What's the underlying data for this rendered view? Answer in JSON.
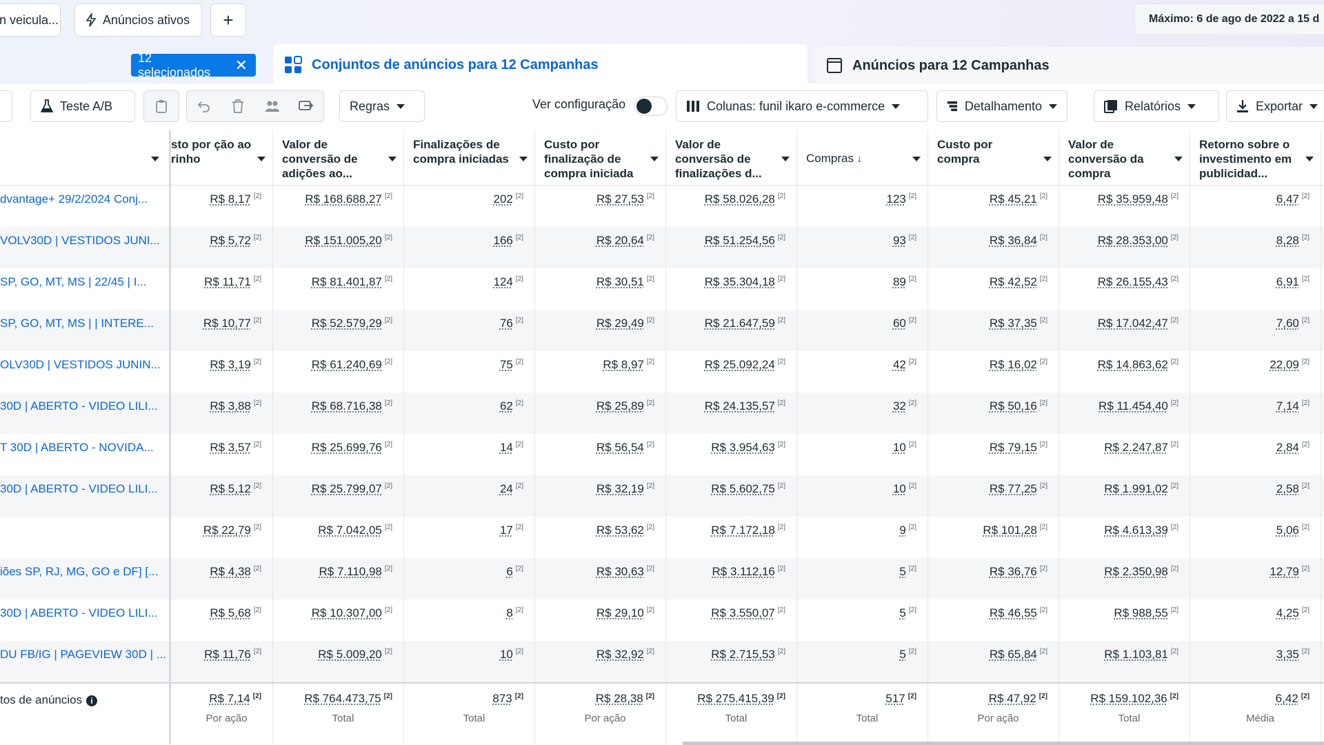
{
  "top_chips": {
    "left_partial": "n veicula...",
    "active_ads": "Anúncios ativos",
    "plus": "+"
  },
  "date_range": "Máximo: 6 de ago de 2022 a 15 d",
  "selection": {
    "label": "12 selecionados",
    "clear": "✕"
  },
  "tabs": {
    "adsets": "Conjuntos de anúncios para 12 Campanhas",
    "ads": "Anúncios para 12 Campanhas"
  },
  "toolbar": {
    "ab_test": "Teste A/B",
    "rules": "Regras",
    "view_config": "Ver configuração",
    "columns": "Colunas: funil ikaro e-commerce",
    "breakdown": "Detalhamento",
    "reports": "Relatórios",
    "export": "Exportar"
  },
  "table": {
    "headers": [
      "sto por ção ao rinho",
      "Valor de conversão de adições ao...",
      "Finalizações de compra iniciadas",
      "Custo por finalização de compra iniciada",
      "Valor de conversão de finalizações d...",
      "Compras",
      "Custo por compra",
      "Valor de conversão da compra",
      "Retorno sobre o investimento em publicidad..."
    ],
    "sup": "[2]",
    "rows": [
      {
        "name": "dvantage+ 29/2/2024 Conj...",
        "cells": [
          "R$ 8,17",
          "R$ 168.688,27",
          "202",
          "R$ 27,53",
          "R$ 58.026,28",
          "123",
          "R$ 45,21",
          "R$ 35.959,48",
          "6,47"
        ]
      },
      {
        "name": "VOLV30D | VESTIDOS JUNI...",
        "cells": [
          "R$ 5,72",
          "R$ 151.005,20",
          "166",
          "R$ 20,64",
          "R$ 51.254,56",
          "93",
          "R$ 36,84",
          "R$ 28.353,00",
          "8,28"
        ]
      },
      {
        "name": " SP, GO, MT, MS | 22/45 | I...",
        "cells": [
          "R$ 11,71",
          "R$ 81.401,87",
          "124",
          "R$ 30,51",
          "R$ 35.304,18",
          "89",
          "R$ 42,52",
          "R$ 26.155,43",
          "6,91"
        ]
      },
      {
        "name": " SP, GO, MT, MS | | INTERE...",
        "cells": [
          "R$ 10,77",
          "R$ 52.579,29",
          "76",
          "R$ 29,49",
          "R$ 21.647,59",
          "60",
          "R$ 37,35",
          "R$ 17.042,47",
          "7,60"
        ]
      },
      {
        "name": "OLV30D | VESTIDOS JUNIN...",
        "cells": [
          "R$ 3,19",
          "R$ 61.240,69",
          "75",
          "R$ 8,97",
          "R$ 25.092,24",
          "42",
          "R$ 16,02",
          "R$ 14.863,62",
          "22,09"
        ]
      },
      {
        "name": "30D | ABERTO - VIDEO LILI...",
        "cells": [
          "R$ 3,88",
          "R$ 68.716,38",
          "62",
          "R$ 25,89",
          "R$ 24.135,57",
          "32",
          "R$ 50,16",
          "R$ 11.454,40",
          "7,14"
        ]
      },
      {
        "name": "T 30D | ABERTO - NOVIDA...",
        "cells": [
          "R$ 3,57",
          "R$ 25.699,76",
          "14",
          "R$ 56,54",
          "R$ 3.954,63",
          "10",
          "R$ 79,15",
          "R$ 2.247,87",
          "2,84"
        ]
      },
      {
        "name": "30D | ABERTO - VIDEO LILI...",
        "cells": [
          "R$ 5,12",
          "R$ 25.799,07",
          "24",
          "R$ 32,19",
          "R$ 5.602,75",
          "10",
          "R$ 77,25",
          "R$ 1.991,02",
          "2,58"
        ]
      },
      {
        "name": "",
        "cells": [
          "R$ 22,79",
          "R$ 7.042,05",
          "17",
          "R$ 53,62",
          "R$ 7.172,18",
          "9",
          "R$ 101,28",
          "R$ 4.613,39",
          "5,06"
        ]
      },
      {
        "name": "iões SP, RJ, MG, GO e DF] [...",
        "cells": [
          "R$ 4,38",
          "R$ 7.110,98",
          "6",
          "R$ 30,63",
          "R$ 3.112,16",
          "5",
          "R$ 36,76",
          "R$ 2.350,98",
          "12,79"
        ]
      },
      {
        "name": "30D | ABERTO - VIDEO LILI...",
        "cells": [
          "R$ 5,68",
          "R$ 10.307,00",
          "8",
          "R$ 29,10",
          "R$ 3.550,07",
          "5",
          "R$ 46,55",
          "R$ 988,55",
          "4,25"
        ]
      },
      {
        "name": "DU FB/IG | PAGEVIEW 30D | ...",
        "cells": [
          "R$ 11,76",
          "R$ 5.009,20",
          "10",
          "R$ 32,92",
          "R$ 2.715,53",
          "5",
          "R$ 65,84",
          "R$ 1.103,81",
          "3,35"
        ]
      }
    ],
    "totals": {
      "name": "tos de anúncios",
      "info": "i",
      "cells": [
        {
          "value": "R$ 7,14",
          "label": "Por ação"
        },
        {
          "value": "R$ 764.473,75",
          "label": "Total"
        },
        {
          "value": "873",
          "label": "Total"
        },
        {
          "value": "R$ 28,38",
          "label": "Por ação"
        },
        {
          "value": "R$ 275.415,39",
          "label": "Total"
        },
        {
          "value": "517",
          "label": "Total"
        },
        {
          "value": "R$ 47,92",
          "label": "Por ação"
        },
        {
          "value": "R$ 159.102,36",
          "label": "Total"
        },
        {
          "value": "6,42",
          "label": "Média"
        }
      ]
    }
  },
  "colors": {
    "accent": "#0a66d6",
    "pill": "#0a78e6"
  }
}
